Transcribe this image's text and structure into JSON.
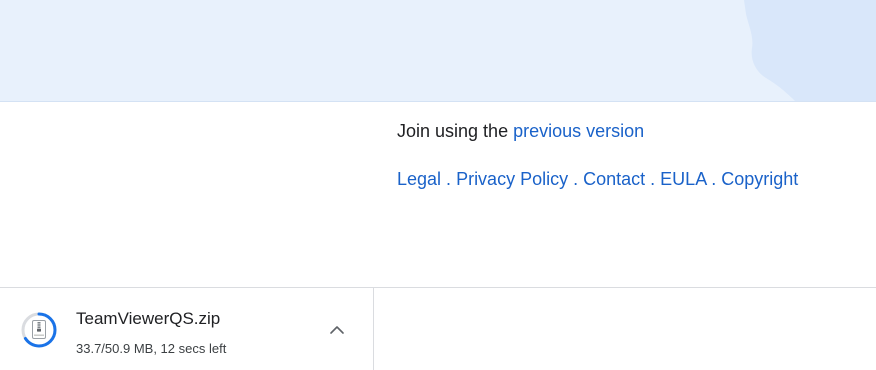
{
  "footer": {
    "join_prefix": "Join using the ",
    "join_link": "previous version",
    "links": [
      {
        "label": "Legal"
      },
      {
        "label": "Privacy Policy"
      },
      {
        "label": "Contact"
      },
      {
        "label": "EULA"
      },
      {
        "label": "Copyright"
      }
    ],
    "separator": " . "
  },
  "download": {
    "file_name": "TeamViewerQS.zip",
    "status": "33.7/50.9 MB, 12 secs left",
    "progress_fraction": 0.66,
    "expand_icon": "chevron-up-icon"
  },
  "colors": {
    "link": "#1a62c9",
    "banner": "#e8f1fc",
    "progress": "#1a73e8"
  }
}
